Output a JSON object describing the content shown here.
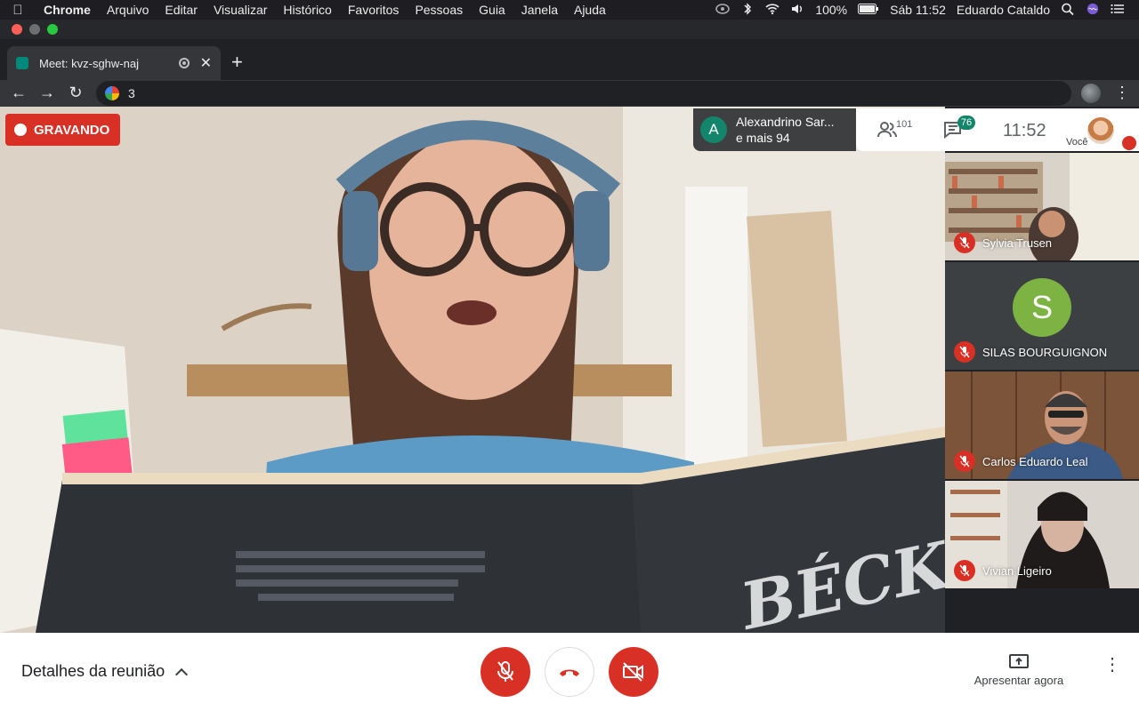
{
  "menubar": {
    "app": "Chrome",
    "items": [
      "Arquivo",
      "Editar",
      "Visualizar",
      "Histórico",
      "Favoritos",
      "Pessoas",
      "Guia",
      "Janela",
      "Ajuda"
    ],
    "battery": "100%",
    "datetime": "Sáb 11:52",
    "user": "Eduardo Cataldo"
  },
  "browser": {
    "tab_title": "Meet: kvz-sghw-naj",
    "address": "3"
  },
  "meet": {
    "recording_label": "GRAVANDO",
    "presenter": {
      "initial": "A",
      "name": "Alexandrino Sar...",
      "more": "e mais 94"
    },
    "people_count": "101",
    "chat_count": "76",
    "clock": "11:52",
    "self_label": "Você",
    "book_text": "BÉCKETT",
    "participants": [
      {
        "name": "Sylvia Trusen"
      },
      {
        "name": "SILAS BOURGUIGNON",
        "initial": "S"
      },
      {
        "name": "Carlos Eduardo Leal"
      },
      {
        "name": "Vivian Ligeiro"
      }
    ],
    "details_label": "Detalhes da reunião",
    "present_label": "Apresentar agora"
  }
}
